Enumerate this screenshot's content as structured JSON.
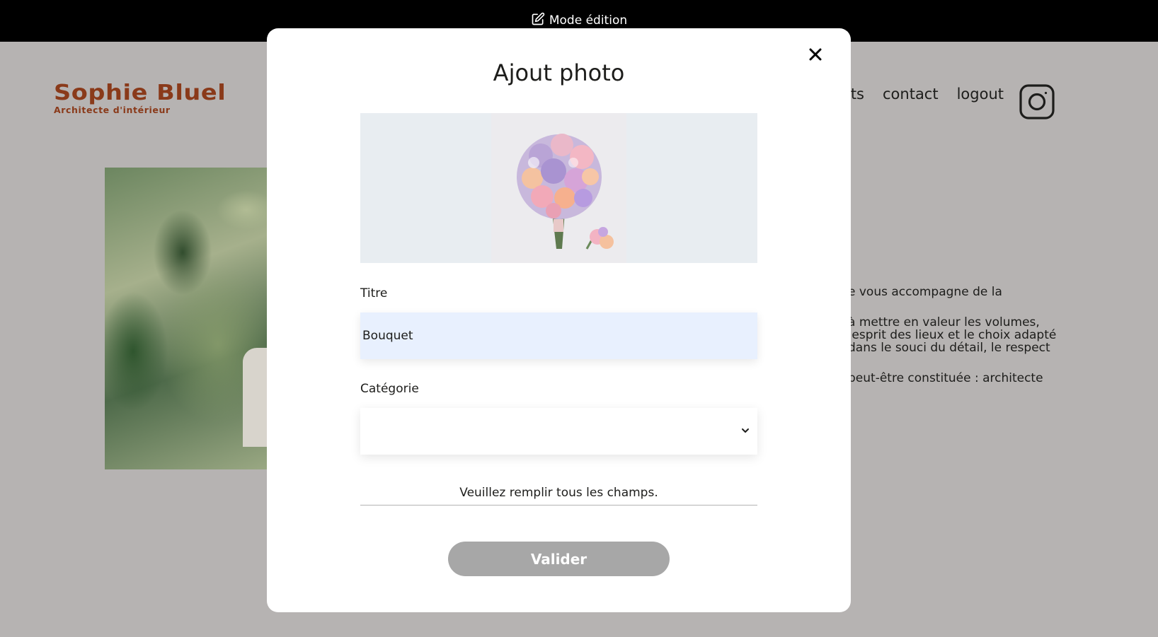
{
  "edit_bar": {
    "icon": "edit-icon",
    "label": "Mode édition"
  },
  "header": {
    "logo_title": "Sophie Bluel",
    "logo_subtitle": "Architecte d'intérieur",
    "nav": [
      "ts",
      "contact",
      "logout"
    ],
    "social_icon": "instagram-icon"
  },
  "intro": {
    "paragraphs": [
      "e vous accompagne de la",
      "à mettre en valeur les volumes,\n’esprit des lieux et le choix adapté\ndans le souci du détail, le respect",
      "peut-être constituée : architecte"
    ]
  },
  "modal": {
    "close_icon": "close-icon",
    "title": "Ajout photo",
    "preview_alt": "bouquet-photo",
    "title_label": "Titre",
    "title_value": "Bouquet",
    "category_label": "Catégorie",
    "category_value": "",
    "error_message": "Veuillez remplir tous les champs.",
    "submit_label": "Valider"
  },
  "colors": {
    "brand": "#8a3a1a",
    "overlay_bg": "#b6b3b2",
    "input_autofill": "#e8f0fe",
    "button_disabled": "#a7a7a7"
  }
}
